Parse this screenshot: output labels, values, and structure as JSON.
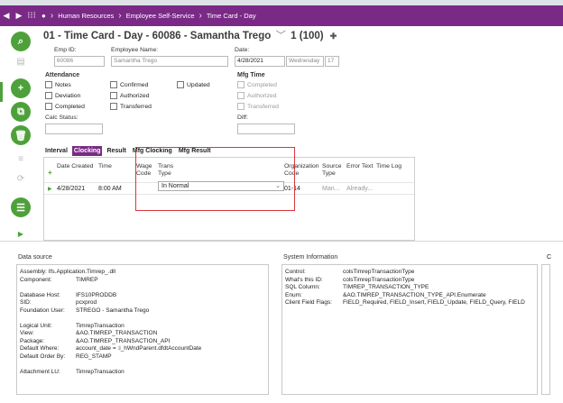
{
  "topbar": {
    "home_icon": "home-icon",
    "crumbs": [
      "Human Resources",
      "Employee Self-Service",
      "Time Card - Day"
    ]
  },
  "page": {
    "title": "01 - Time Card - Day - 60086 - Samantha Trego",
    "record": "1 (100)"
  },
  "header_fields": {
    "emp_id_label": "Emp ID:",
    "emp_id": "60086",
    "employee_name_label": "Employee Name:",
    "employee_name": "Samantha Trego",
    "date_label": "Date:",
    "date": "4/28/2021",
    "weekday": "Wednesday",
    "week_num": "17",
    "calc_status_label": "Calc Status:",
    "diff_label": "Diff:"
  },
  "attendance": {
    "title": "Attendance",
    "items": [
      "Notes",
      "Confirmed",
      "Updated",
      "Deviation",
      "Authorized",
      "Completed",
      "Transferred"
    ]
  },
  "mfg_time": {
    "title": "Mfg Time",
    "items": [
      "Completed",
      "Authorized",
      "Transferred"
    ]
  },
  "tabs": [
    "Interval",
    "Clocking",
    "Result",
    "Mfg Clocking",
    "Mfg Result"
  ],
  "grid": {
    "headers": {
      "date_created": "Date Created",
      "time": "Time",
      "wage_code": "Wage Code",
      "trans_type": "Trans Type",
      "org_code": "Organization Code",
      "source_type": "Source Type",
      "error_text": "Error Text",
      "time_log": "Time Log"
    },
    "row": {
      "date_created": "4/28/2021",
      "time": "8:00 AM",
      "trans_type": "In Normal",
      "org_code": "01-14",
      "source_type": "Man...",
      "error_text": "Already..."
    }
  },
  "data_source": {
    "title": "Data source",
    "lines": [
      [
        "Assembly: Ifs.Application.Timrep_.dll",
        ""
      ],
      [
        "Component:",
        "TIMREP"
      ],
      [
        "",
        ""
      ],
      [
        "Database Host:",
        "IFS10PRODDB"
      ],
      [
        "SID:",
        "pcxprod"
      ],
      [
        "Foundation User:",
        "STREGO - Samantha Trego"
      ],
      [
        "",
        ""
      ],
      [
        "Logical Unit:",
        "TimrepTransaction"
      ],
      [
        "View:",
        "&AO.TIMREP_TRANSACTION"
      ],
      [
        "Package:",
        "&AO.TIMREP_TRANSACTION_API"
      ],
      [
        "Default Where:",
        "account_date = :i_hWndParent.dfdtAccountDate"
      ],
      [
        "Default Order By:",
        "REG_STAMP"
      ],
      [
        "",
        ""
      ],
      [
        "Attachment LU:",
        "TimrepTransaction"
      ]
    ]
  },
  "system_info": {
    "title": "System Information",
    "lines": [
      [
        "Control:",
        "colsTimrepTransactionType"
      ],
      [
        "What's this ID:",
        "colsTimrepTransactionType"
      ],
      [
        "SQL Column:",
        "TIMREP_TRANSACTION_TYPE"
      ],
      [
        "Enum:",
        "&AO.TIMREP_TRANSACTION_TYPE_API.Enumerate"
      ],
      [
        "Client Field Flags:",
        "FIELD_Required, FIELD_Insert, FIELD_Update, FIELD_Query, FIELD"
      ]
    ]
  },
  "third_panel": {
    "title": "C"
  },
  "colors": {
    "brand": "#7a2a86",
    "accent_green": "#4ea13a",
    "highlight_red": "#d9363e"
  }
}
